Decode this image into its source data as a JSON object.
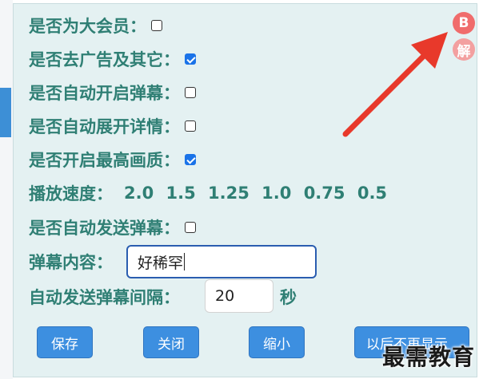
{
  "settings": {
    "vip_label": "是否为大会员：",
    "vip_checked": false,
    "noads_label": "是否去广告及其它：",
    "noads_checked": true,
    "autodanmaku_label": "是否自动开启弹幕：",
    "autodanmaku_checked": false,
    "expand_label": "是否自动展开详情：",
    "expand_checked": false,
    "hq_label": "是否开启最高画质：",
    "hq_checked": true,
    "speed_label": "播放速度：",
    "speeds": [
      "2.0",
      "1.5",
      "1.25",
      "1.0",
      "0.75",
      "0.5"
    ],
    "autosend_label": "是否自动发送弹幕：",
    "autosend_checked": false,
    "content_label": "弹幕内容：",
    "content_value": "好稀罕",
    "interval_label": "自动发送弹幕间隔：",
    "interval_value": "20",
    "interval_unit": "秒"
  },
  "buttons": {
    "save": "保存",
    "close": "关闭",
    "minimize": "缩小",
    "dont_show": "以后不再显示"
  },
  "badges": {
    "b": "B",
    "jie": "解"
  },
  "watermark": "最需教育",
  "colors": {
    "label": "#2f7f74",
    "panel_bg": "#e4f1f2",
    "button": "#3d8fe0",
    "badge": "#f06c6c",
    "arrow": "#e8392b"
  }
}
